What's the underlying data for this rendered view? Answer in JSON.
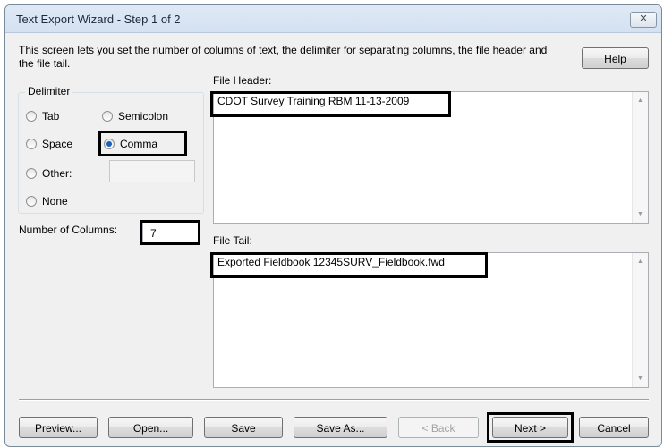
{
  "window": {
    "title": "Text Export Wizard - Step 1 of 2",
    "close_glyph": "✕"
  },
  "description": "This screen lets you set the number of columns of text, the delimiter for separating columns, the file header and the file tail.",
  "help_label": "Help",
  "delimiter": {
    "group_label": "Delimiter",
    "options": {
      "tab": "Tab",
      "semicolon": "Semicolon",
      "space": "Space",
      "comma": "Comma",
      "other": "Other:",
      "none": "None"
    },
    "selected": "Comma",
    "other_value": ""
  },
  "columns": {
    "label": "Number of Columns:",
    "value": "7"
  },
  "file_header": {
    "label": "File Header:",
    "value": "CDOT Survey Training RBM 11-13-2009"
  },
  "file_tail": {
    "label": "File Tail:",
    "value": "Exported Fieldbook 12345SURV_Fieldbook.fwd"
  },
  "buttons": {
    "preview": "Preview...",
    "open": "Open...",
    "save": "Save",
    "save_as": "Save As...",
    "back": "< Back",
    "next": "Next >",
    "cancel": "Cancel"
  }
}
